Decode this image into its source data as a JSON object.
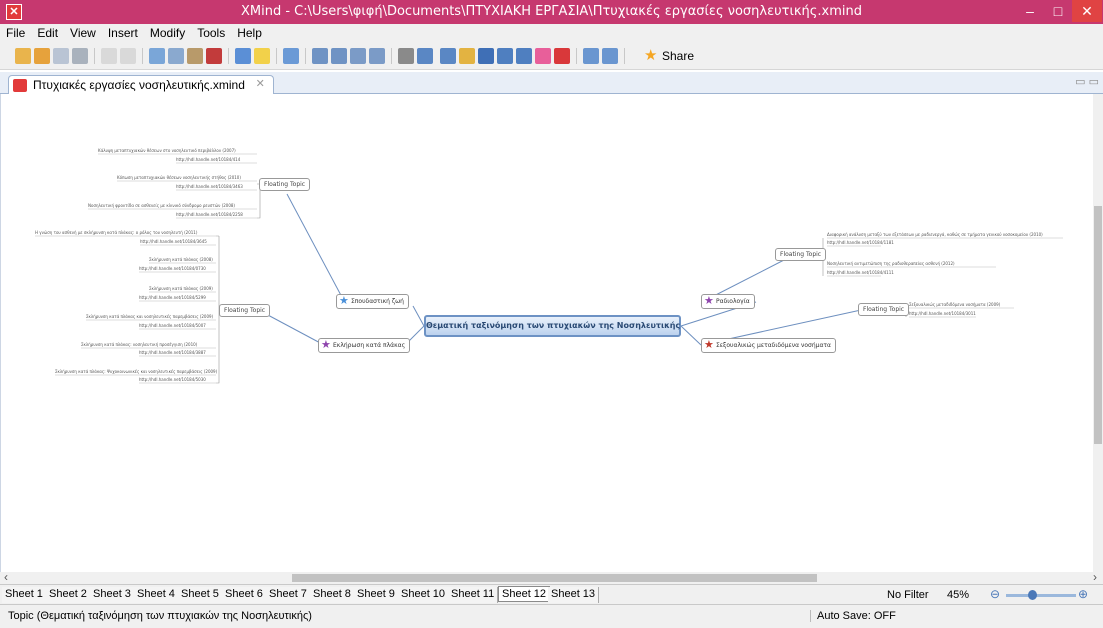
{
  "window": {
    "title": "XMind - C:\\Users\\φιφή\\Documents\\ΠΤΥΧΙΑΚΗ ΕΡΓΑΣΙΑ\\Πτυχιακές εργασίες νοσηλευτικής.xmind",
    "minimize": "–",
    "maximize": "□",
    "close": "✕"
  },
  "menu": [
    "File",
    "Edit",
    "View",
    "Insert",
    "Modify",
    "Tools",
    "Help"
  ],
  "toolbar": {
    "share_label": "Share",
    "icons": [
      "new-icon",
      "open-icon",
      "save-icon",
      "print-icon",
      "undo-icon",
      "redo-icon",
      "cut-icon",
      "copy-icon",
      "paste-icon",
      "delete-icon",
      "topic-icon",
      "idea-icon",
      "marker-icon",
      "relationship-icon",
      "boundary-icon",
      "summary-icon",
      "attachment-icon",
      "image-icon",
      "note-icon",
      "label-icon",
      "hyperlink-icon",
      "equation-icon",
      "style-icon",
      "drill-down-icon",
      "drill-up-icon"
    ]
  },
  "editor_tab": {
    "label": "Πτυχιακές εργασίες νοσηλευτικής.xmind",
    "close": "✕"
  },
  "mindmap": {
    "central": "Θεματική ταξινόμηση των πτυχιακών της Νοσηλευτικής",
    "main_topics": [
      {
        "label": "Σπουδαστική ζωή",
        "star_color": "#4a90d9"
      },
      {
        "label": "Εκλήρωση κατά πλάκας",
        "star_color": "#8e44ad"
      },
      {
        "label": "Ραδιολογία",
        "star_color": "#8e44ad"
      },
      {
        "label": "Σεξουαλικώς μεταδιδόμενα νοσήματα",
        "star_color": "#c0392b"
      }
    ],
    "floating_label": "Floating Topic",
    "leaves_top_left": [
      "Κάλυψη μεταπτυχιακών θέσεων στο νοσηλευτικό περιβάλλον (2007)",
      "http://hdl.handle.net/10184/414",
      "Κόπωση μεταπτυχιακών θέσεων νοσηλευτικής στήθος (2010)",
      "http://hdl.handle.net/10184/3463",
      "Νοσηλευτική φροντίδα σε ασθενείς με κλινικό σύνδρομο ρευστών (2008)",
      "http://hdl.handle.net/10184/2258"
    ],
    "leaves_left": [
      "Η γνώση του ασθενή με σκλήρυνση κατά πλάκας: ο ρόλος του νοσηλευτή (2011)",
      "http://hdl.handle.net/10184/3645",
      "Σκλήρυνση κατά πλάκας (2008)",
      "http://hdl.handle.net/10184/0730",
      "Σκλήρυνση κατά πλάκας (2009)",
      "http://hdl.handle.net/10184/5299",
      "Σκλήρυνση κατά πλάκας και νοσηλευτικές παρεμβάσεις (2009)",
      "http://hdl.handle.net/10184/5007",
      "Σκλήρυνση κατά πλάκας: νοσηλευτική προσέγγιση (2010)",
      "http://hdl.handle.net/10184/3887",
      "Σκλήρυνση κατά πλάκας: Ψυχοκοινωνικές και νοσηλευτικές παρεμβάσεις (2009)",
      "http://hdl.handle.net/10184/5030"
    ],
    "leaves_right_top": [
      "Διαφορική ανάλυση μεταξύ των εξετάσεων με ραδιενεργά, καθώς σε τμήματα γενικού νοσοκομείου (2010)",
      "http://hdl.handle.net/10184/1181",
      "Νοσηλευτική αντιμετώπιση της ραδιοθεραπείας ασθενή (2012)",
      "http://hdl.handle.net/10184/4111"
    ],
    "leaves_right_bottom": [
      "Σεξουαλικώς μεταδιδόμενα νοσήματα (2009)",
      "http://hdl.handle.net/10184/3011"
    ]
  },
  "sheets": [
    "Sheet 1",
    "Sheet 2",
    "Sheet 3",
    "Sheet 4",
    "Sheet 5",
    "Sheet 6",
    "Sheet 7",
    "Sheet 8",
    "Sheet 9",
    "Sheet 10",
    "Sheet 11",
    "Sheet 12",
    "Sheet 13"
  ],
  "active_sheet": "Sheet 12",
  "filter_label": "No Filter",
  "zoom_label": "45%",
  "status": {
    "topic": "Topic (Θεματική ταξινόμηση των πτυχιακών της Νοσηλευτικής)",
    "autosave": "Auto Save: OFF"
  }
}
